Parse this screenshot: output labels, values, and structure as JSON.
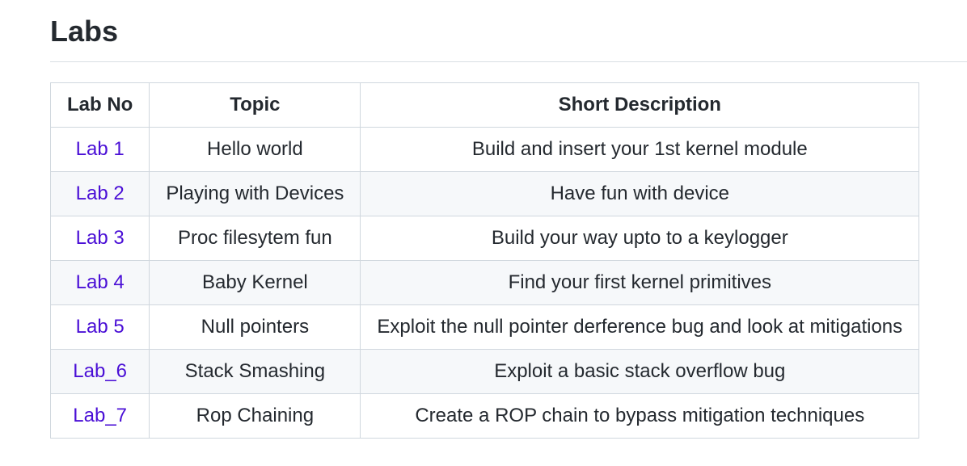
{
  "page": {
    "title": "Labs"
  },
  "table": {
    "headers": {
      "lab_no": "Lab No",
      "topic": "Topic",
      "description": "Short Description"
    },
    "rows": [
      {
        "lab": "Lab 1",
        "topic": "Hello world",
        "description": "Build and insert your 1st kernel module"
      },
      {
        "lab": "Lab 2",
        "topic": "Playing with Devices",
        "description": "Have fun with device"
      },
      {
        "lab": "Lab 3",
        "topic": "Proc filesytem fun",
        "description": "Build your way upto to a keylogger"
      },
      {
        "lab": "Lab 4",
        "topic": "Baby Kernel",
        "description": "Find your first kernel primitives"
      },
      {
        "lab": "Lab 5",
        "topic": "Null pointers",
        "description": "Exploit the null pointer derference bug and look at mitigations"
      },
      {
        "lab": "Lab_6",
        "topic": "Stack Smashing",
        "description": "Exploit a basic stack overflow bug"
      },
      {
        "lab": "Lab_7",
        "topic": "Rop Chaining",
        "description": "Create a ROP chain to bypass mitigation techniques"
      }
    ]
  },
  "colors": {
    "link": "#4a0fd6",
    "text": "#24292f",
    "border": "#d0d7de",
    "stripe": "#f6f8fa"
  }
}
